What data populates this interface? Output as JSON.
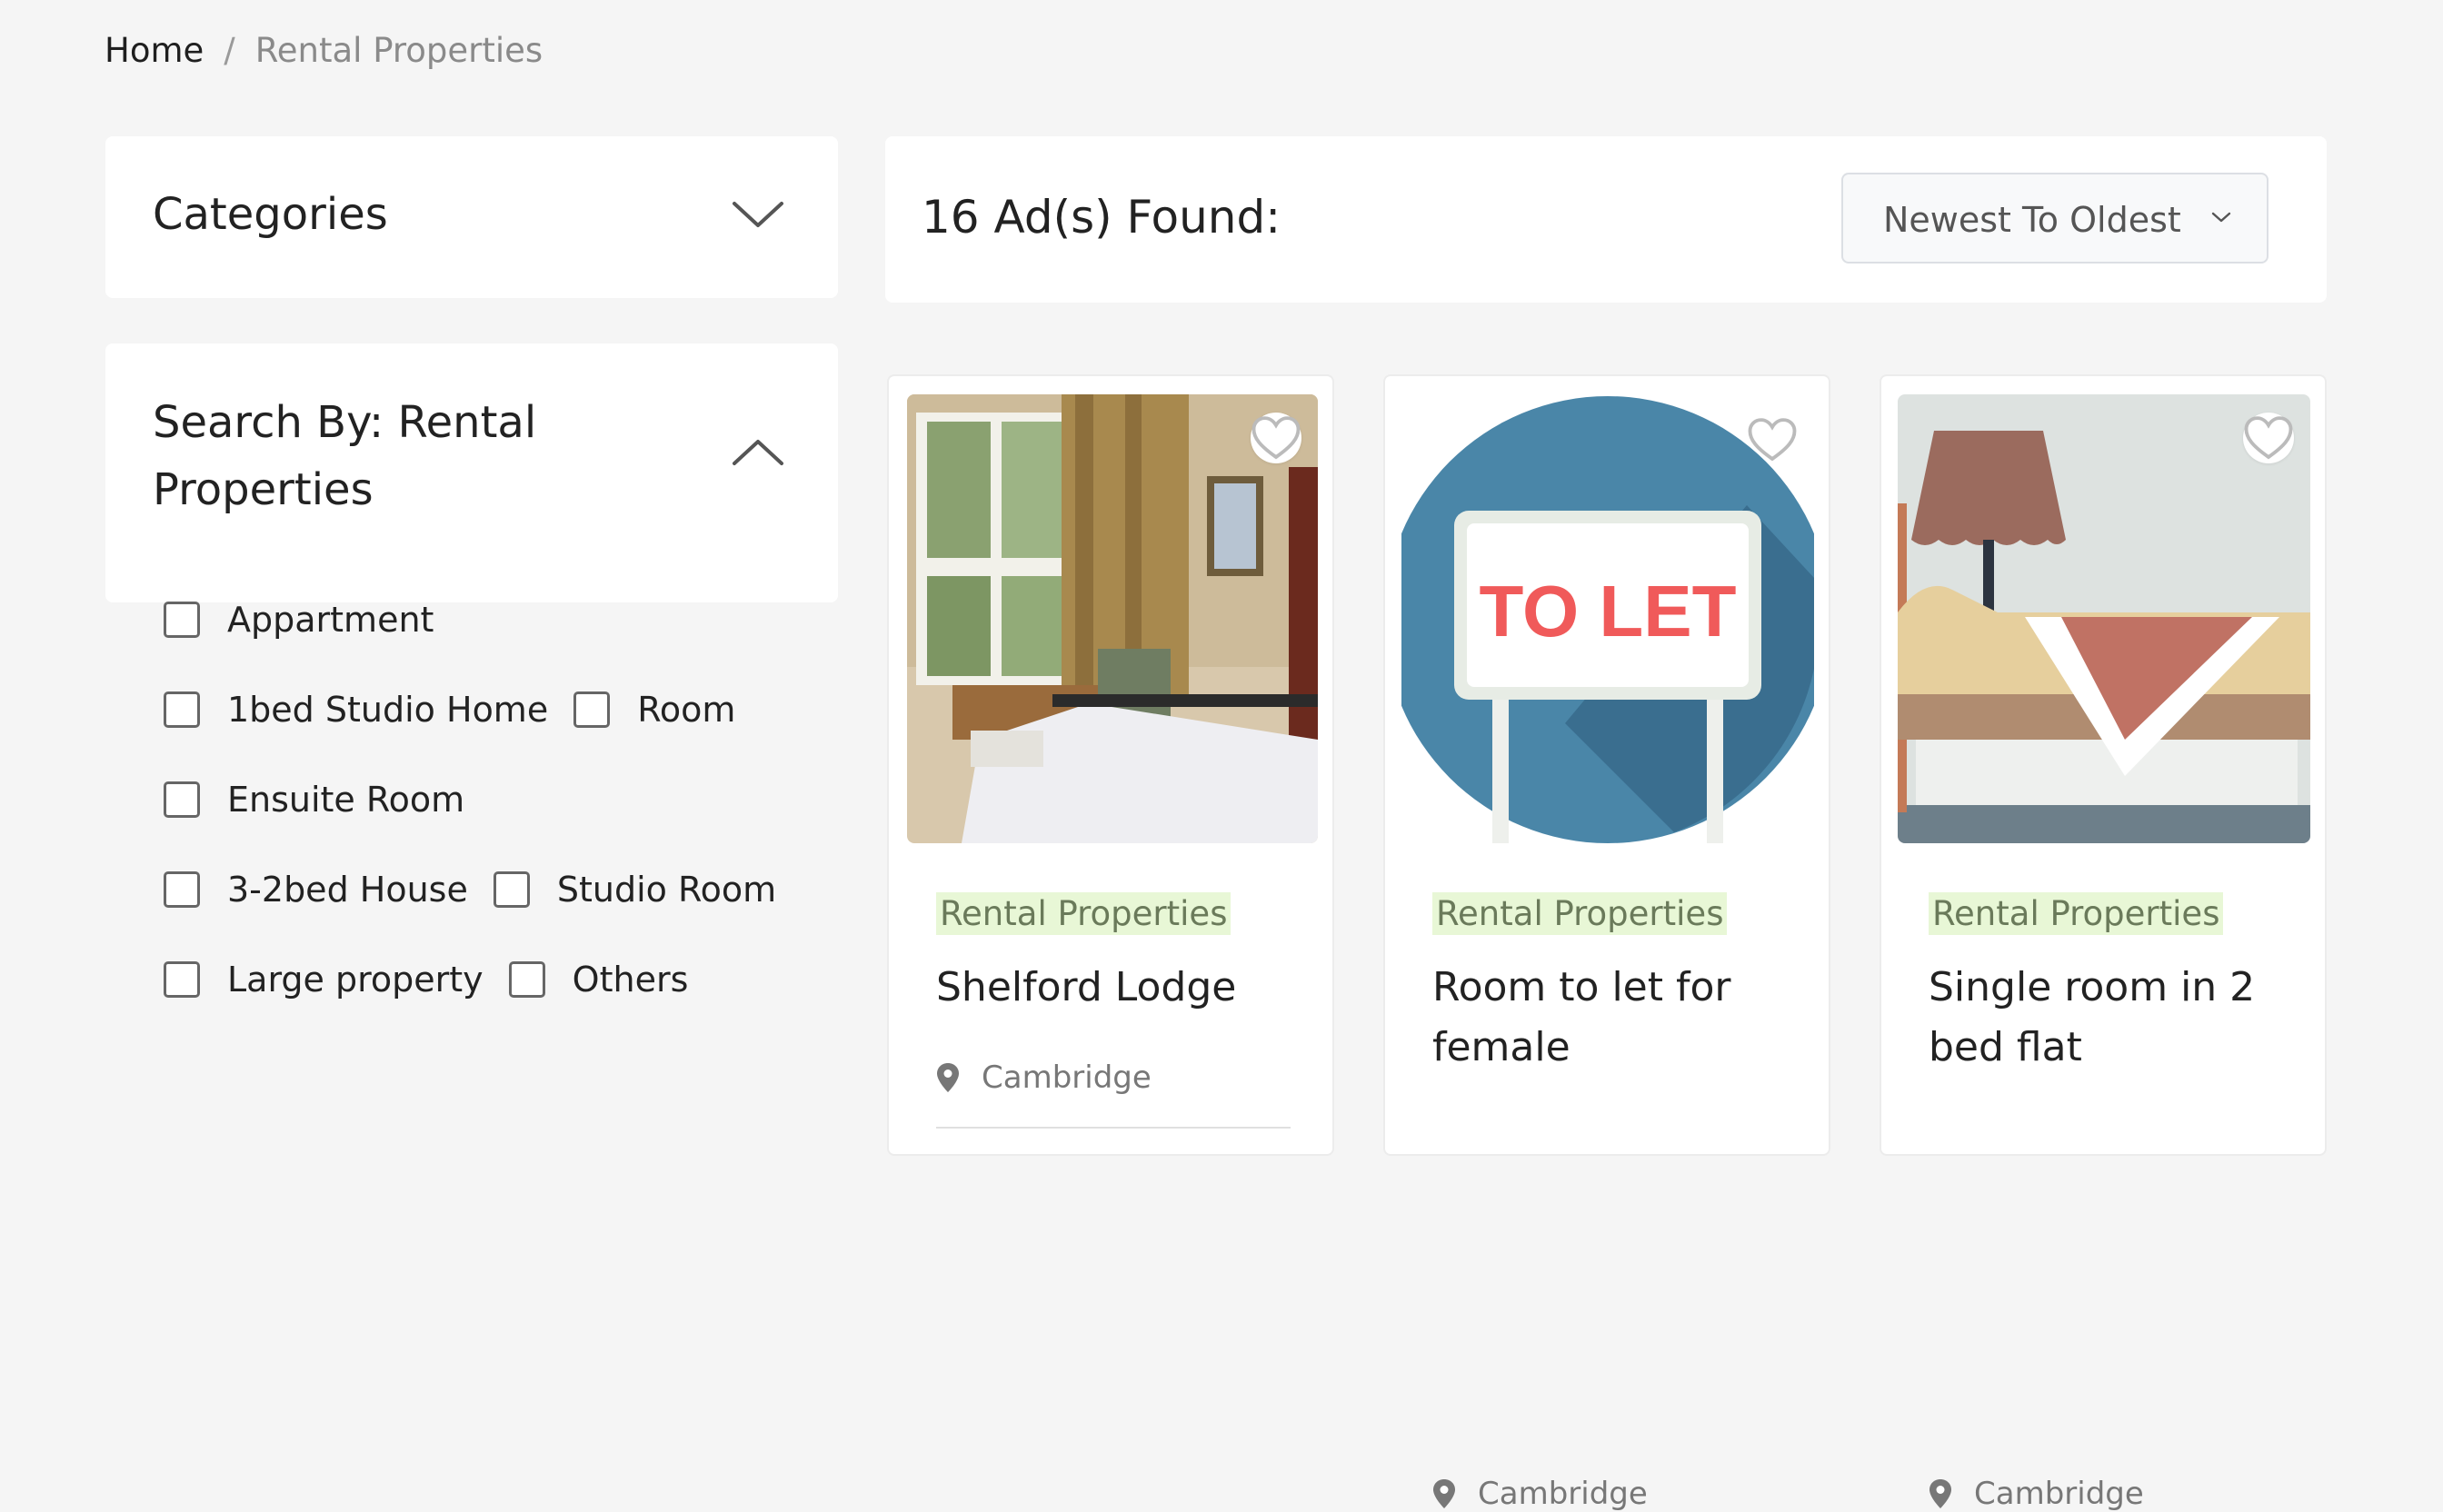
{
  "breadcrumb": {
    "home": "Home",
    "separator": "/",
    "current": "Rental Properties"
  },
  "categories_panel": {
    "title": "Categories",
    "expanded": false
  },
  "search_panel": {
    "title": "Search By: Rental Properties",
    "expanded": true,
    "options": [
      {
        "label": "Appartment",
        "checked": false
      },
      {
        "label": "1bed Studio Home",
        "checked": false
      },
      {
        "label": "Room",
        "checked": false
      },
      {
        "label": "Ensuite Room",
        "checked": false
      },
      {
        "label": "3-2bed House",
        "checked": false
      },
      {
        "label": "Studio Room",
        "checked": false
      },
      {
        "label": "Large property",
        "checked": false
      },
      {
        "label": "Others",
        "checked": false
      }
    ]
  },
  "results": {
    "count_text": "16 Ad(s) Found:",
    "sort_selected": "Newest To Oldest"
  },
  "listings": [
    {
      "category": "Rental Properties",
      "title": "Shelford Lodge",
      "location": "Cambridge",
      "image": "bedroom-photo"
    },
    {
      "category": "Rental Properties",
      "title": "Room to let for female",
      "location": "Cambridge",
      "image": "to-let-sign",
      "image_text": "TO LET"
    },
    {
      "category": "Rental Properties",
      "title": "Single room in 2 bed flat",
      "location": "Cambridge",
      "image": "bed-and-lamp-illustration"
    }
  ],
  "colors": {
    "background": "#f5f5f5",
    "tag_bg": "#e8f7d6",
    "tag_text": "#6a7a5a",
    "to_let_red": "#f05a5a",
    "sign_blue": "#3f7ea3"
  },
  "icons": {
    "favorite": "heart-outline-icon",
    "location": "map-pin-icon",
    "collapse": "chevron-up-icon",
    "expand": "chevron-down-icon"
  }
}
